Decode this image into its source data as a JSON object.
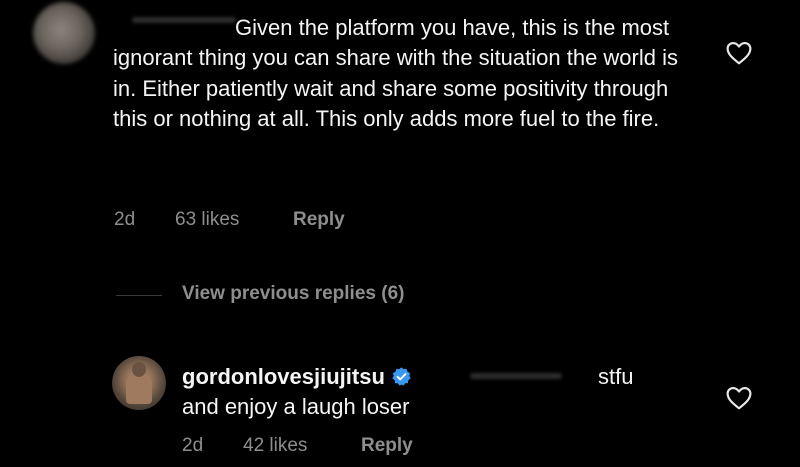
{
  "comment": {
    "text_first": "Given the platform you have, this is",
    "text_rest": "the most ignorant thing you can share with the situation the world is in. Either patiently wait and share some positivity through this or nothing at all. This only adds more fuel to the fire.",
    "time": "2d",
    "likes": "63 likes",
    "reply_label": "Reply"
  },
  "view_replies": {
    "label": "View previous replies (6)"
  },
  "reply": {
    "username": "gordonlovesjiujitsu",
    "text_inline": "stfu",
    "text_continued": "and enjoy a laugh loser",
    "time": "2d",
    "likes": "42 likes",
    "reply_label": "Reply"
  },
  "colors": {
    "background": "#000000",
    "text": "#f5f5f5",
    "muted": "#8e8e8e",
    "verified": "#3897f0"
  },
  "icons": {
    "like": "heart-outline-icon",
    "verified": "verified-badge-icon"
  }
}
